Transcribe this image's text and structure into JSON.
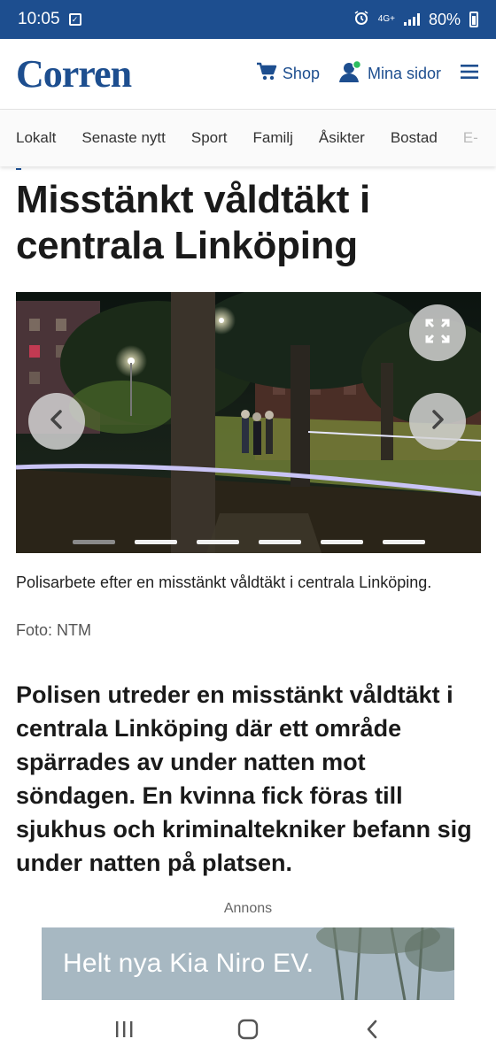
{
  "status_bar": {
    "time": "10:05",
    "network": "4G+",
    "battery": "80%"
  },
  "header": {
    "logo": "Corren",
    "shop_label": "Shop",
    "account_label": "Mina sidor",
    "brand_color": "#1d4e8f"
  },
  "nav": {
    "items": [
      "Lokalt",
      "Senaste nytt",
      "Sport",
      "Familj",
      "Åsikter",
      "Bostad",
      "E-"
    ]
  },
  "article": {
    "headline": "Misstänkt våldtäkt i centrala Linköping",
    "gallery": {
      "slide_count": 6,
      "active_slide": 1
    },
    "caption": "Polisarbete efter en misstänkt våldtäkt i centrala Linköping.",
    "credit": "Foto: NTM",
    "lead": "Polisen utreder en misstänkt våldtäkt i centrala Linköping där ett område spärrades av under natten mot söndagen. En kvinna fick föras till sjukhus och kriminaltekniker befann sig under natten på platsen."
  },
  "ad": {
    "label": "Annons",
    "text": "Helt nya Kia Niro EV."
  },
  "icons": {
    "cart": "cart-icon",
    "account": "account-icon",
    "menu": "hamburger-menu-icon",
    "fullscreen": "fullscreen-icon",
    "prev": "chevron-left-icon",
    "next": "chevron-right-icon"
  }
}
